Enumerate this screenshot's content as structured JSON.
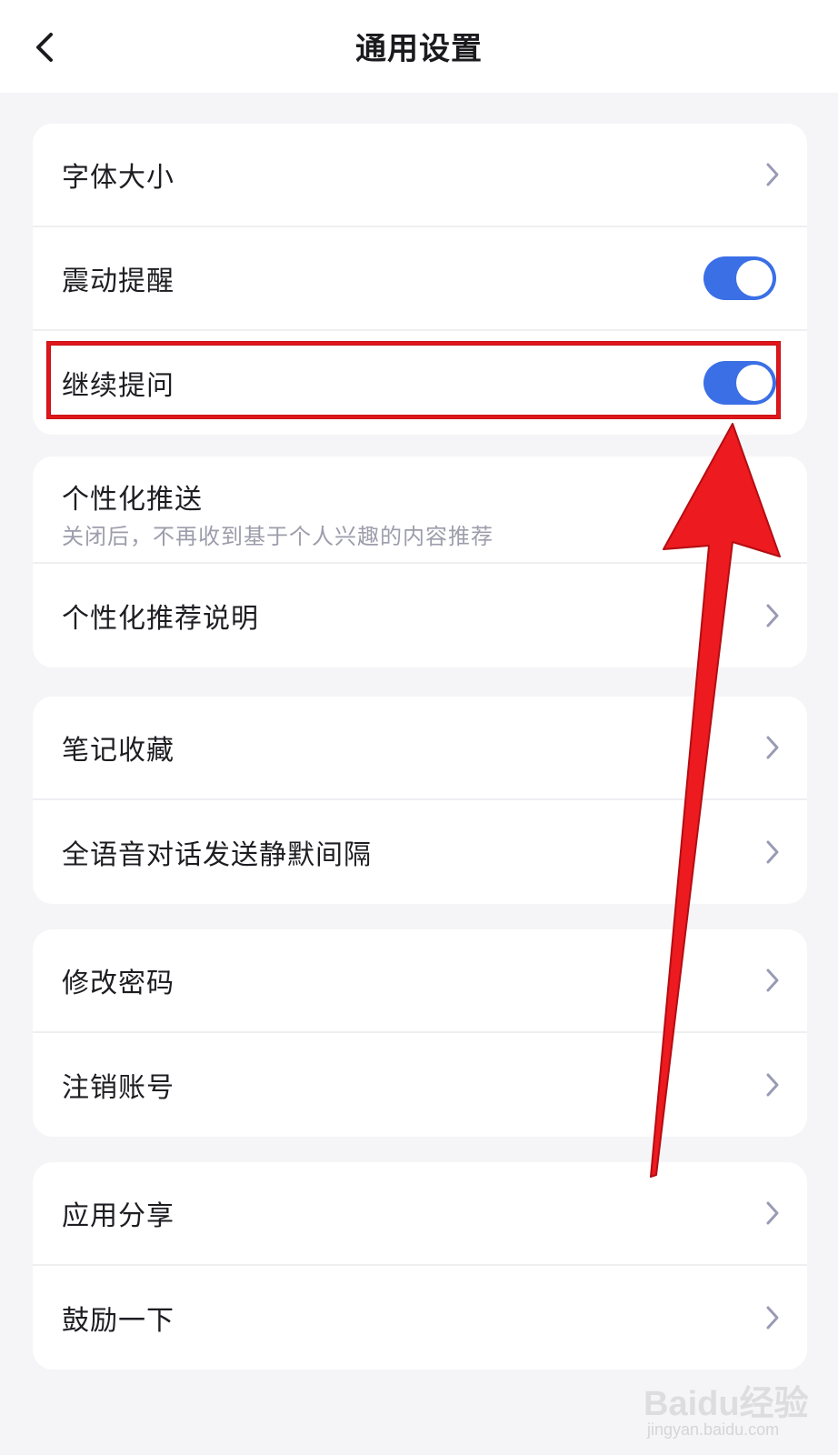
{
  "header": {
    "title": "通用设置",
    "back_icon": "chevron-left-icon"
  },
  "groups": [
    {
      "rows": [
        {
          "label": "字体大小",
          "control": "chevron"
        },
        {
          "label": "震动提醒",
          "control": "toggle",
          "on": true
        },
        {
          "label": "继续提问",
          "control": "toggle",
          "on": true,
          "highlighted": true
        }
      ]
    },
    {
      "rows": [
        {
          "label": "个性化推送",
          "sublabel": "关闭后，不再收到基于个人兴趣的内容推荐"
        },
        {
          "label": "个性化推荐说明",
          "control": "chevron"
        }
      ]
    },
    {
      "rows": [
        {
          "label": "笔记收藏",
          "control": "chevron"
        },
        {
          "label": "全语音对话发送静默间隔",
          "control": "chevron"
        }
      ]
    },
    {
      "rows": [
        {
          "label": "修改密码",
          "control": "chevron"
        },
        {
          "label": "注销账号",
          "control": "chevron"
        }
      ]
    },
    {
      "rows": [
        {
          "label": "应用分享",
          "control": "chevron"
        },
        {
          "label": "鼓励一下",
          "control": "chevron"
        }
      ]
    }
  ],
  "colors": {
    "toggle_on": "#3b6fe6",
    "annotation_red": "#e0161b",
    "background": "#f5f5f7"
  },
  "watermark": {
    "brand": "Baidu经验",
    "url": "jingyan.baidu.com"
  }
}
